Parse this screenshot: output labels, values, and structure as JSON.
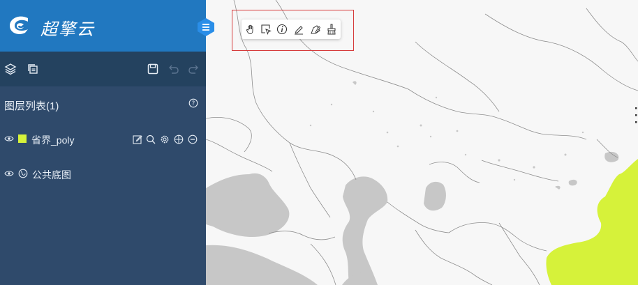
{
  "brand": {
    "name": "超擎云"
  },
  "sidebar": {
    "layer_list_title": "图层列表(1)",
    "layers": [
      {
        "name": "省界_poly",
        "swatch_color": "#d6f23a"
      },
      {
        "name": "公共底图"
      }
    ]
  },
  "colors": {
    "brand_blue": "#2178c0",
    "sidebar_bg": "#2f4a6b",
    "toolbar_bg": "#24425f",
    "map_land": "#f7f7f7",
    "water": "#c7c7c7",
    "highlight_region": "#d6f23a"
  },
  "icons": {
    "sidebar_toolbar": [
      "layers-icon",
      "copy-icon",
      "save-icon",
      "undo-icon",
      "redo-icon"
    ],
    "layer_ops": [
      "edit-icon",
      "zoom-icon",
      "settings-icon",
      "locate-icon",
      "remove-icon"
    ],
    "map_tools": [
      "pan-hand-icon",
      "select-icon",
      "info-icon",
      "draw-line-icon",
      "draw-polygon-icon",
      "clear-icon"
    ]
  }
}
